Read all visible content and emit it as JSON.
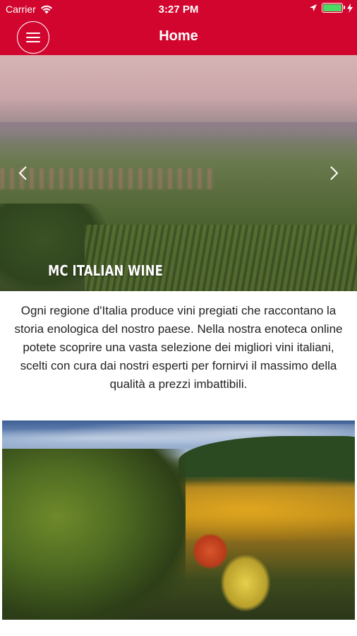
{
  "status_bar": {
    "carrier": "Carrier",
    "time": "3:27 PM",
    "battery_level": 1.0,
    "battery_color": "#4cd964",
    "icons": [
      "wifi-icon",
      "location-arrow-icon",
      "battery-icon",
      "charging-bolt-icon"
    ]
  },
  "nav": {
    "title": "Home",
    "menu_icon": "hamburger-menu-icon",
    "background": "#d2052e"
  },
  "hero": {
    "caption": "MC ITALIAN WINE",
    "prev_icon": "chevron-left-icon",
    "next_icon": "chevron-right-icon"
  },
  "intro": {
    "text": "Ogni regione d'Italia produce vini pregiati che raccontano la storia enologica del nostro paese. Nella nostra enoteca online potete scoprire una vasta selezione dei migliori vini italiani, scelti con cura dai nostri esperti per fornirvi il massimo della qualità a prezzi imbattibili."
  }
}
